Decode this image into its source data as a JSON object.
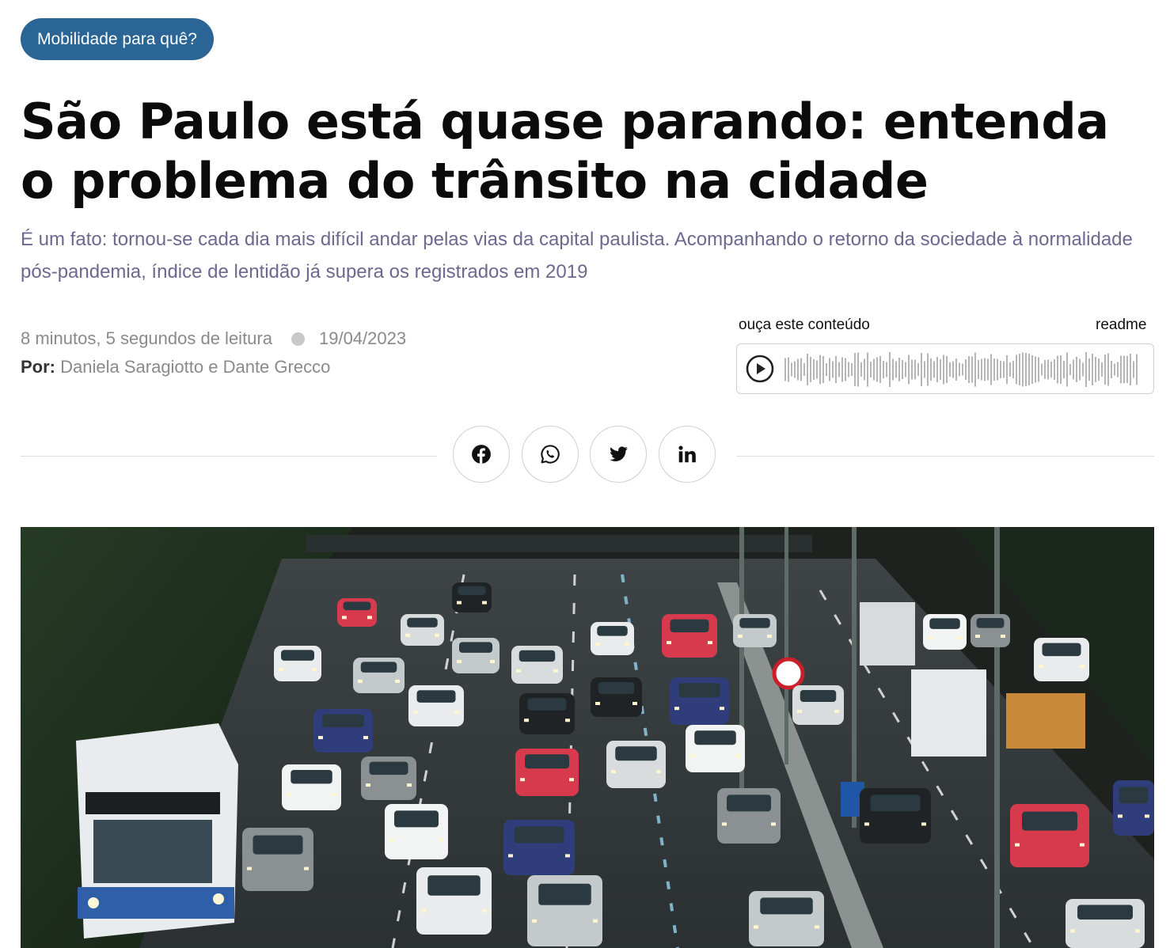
{
  "tag": {
    "label": "Mobilidade para quê?"
  },
  "article": {
    "title": "São Paulo está quase parando: entenda o problema do trânsito na cidade",
    "subtitle": "É um fato: tornou-se cada dia mais difícil andar pelas vias da capital paulista. Acompanhando o retorno da sociedade à normalidade pós-pandemia, índice de lentidão já supera os registrados em 2019",
    "reading_time": "8 minutos, 5 segundos de leitura",
    "date": "19/04/2023",
    "byline_label": "Por:",
    "authors": "Daniela Saragiotto e Dante Grecco"
  },
  "audio": {
    "label": "ouça este conteúdo",
    "brand": "readme",
    "play_icon": "play-circle-icon"
  },
  "share": {
    "icons": [
      "facebook-icon",
      "whatsapp-icon",
      "twitter-icon",
      "linkedin-icon"
    ]
  },
  "colors": {
    "tag_bg": "#2a6595",
    "subtitle": "#6d6890",
    "meta": "#8a8a8a",
    "waveform": "#b5b5b5"
  }
}
